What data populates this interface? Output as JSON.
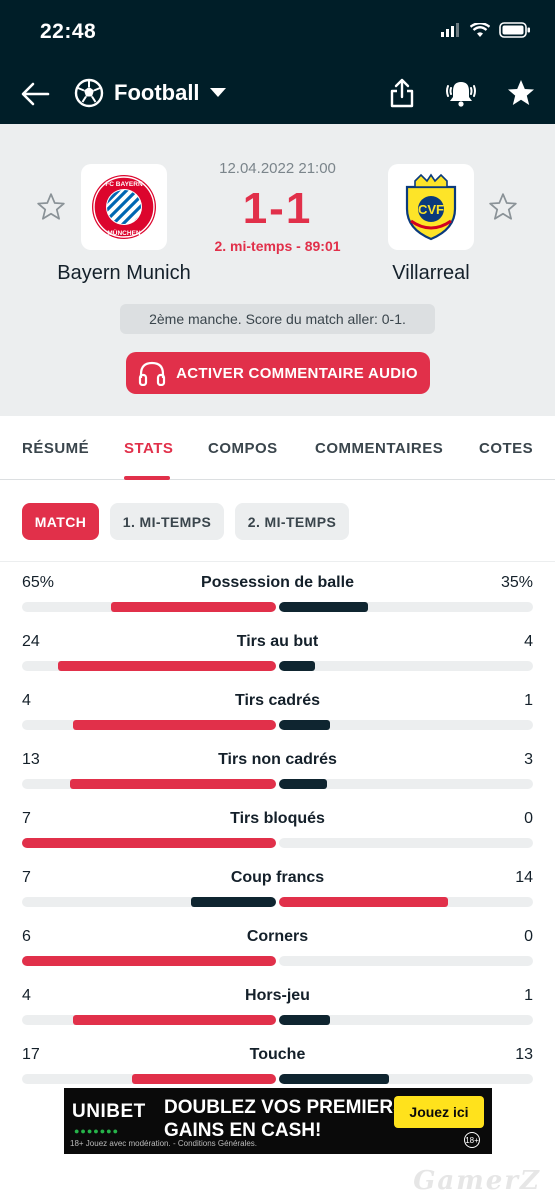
{
  "status_bar": {
    "time": "22:48"
  },
  "app_bar": {
    "sport": "Football"
  },
  "match": {
    "date": "12.04.2022 21:00",
    "score": "1-1",
    "period": "2. mi-temps - 89:01",
    "home_team": "Bayern Munich",
    "away_team": "Villarreal",
    "info": "2ème manche. Score du match aller: 0-1.",
    "audio_button": "ACTIVER COMMENTAIRE AUDIO",
    "home_logo_text": "FC BAYERN MÜNCHEN",
    "away_logo_text": "CVF"
  },
  "tabs": [
    {
      "label": "RÉSUMÉ"
    },
    {
      "label": "STATS"
    },
    {
      "label": "COMPOS"
    },
    {
      "label": "COMMENTAIRES"
    },
    {
      "label": "COTES"
    }
  ],
  "chips": [
    {
      "label": "MATCH"
    },
    {
      "label": "1. MI-TEMPS"
    },
    {
      "label": "2. MI-TEMPS"
    }
  ],
  "colors": {
    "accent": "#e1304a",
    "dark": "#001e28",
    "track": "#eceeef",
    "navy_bar": "#0f2530"
  },
  "stats": [
    {
      "label": "Possession de balle",
      "home": "65%",
      "away": "35%",
      "home_v": 65,
      "away_v": 35
    },
    {
      "label": "Tirs au but",
      "home": "24",
      "away": "4",
      "home_v": 24,
      "away_v": 4
    },
    {
      "label": "Tirs cadrés",
      "home": "4",
      "away": "1",
      "home_v": 4,
      "away_v": 1
    },
    {
      "label": "Tirs non cadrés",
      "home": "13",
      "away": "3",
      "home_v": 13,
      "away_v": 3
    },
    {
      "label": "Tirs bloqués",
      "home": "7",
      "away": "0",
      "home_v": 7,
      "away_v": 0
    },
    {
      "label": "Coup francs",
      "home": "7",
      "away": "14",
      "home_v": 7,
      "away_v": 14
    },
    {
      "label": "Corners",
      "home": "6",
      "away": "0",
      "home_v": 6,
      "away_v": 0
    },
    {
      "label": "Hors-jeu",
      "home": "4",
      "away": "1",
      "home_v": 4,
      "away_v": 1
    },
    {
      "label": "Touche",
      "home": "17",
      "away": "13",
      "home_v": 17,
      "away_v": 13
    }
  ],
  "ad": {
    "brand": "UNIBET",
    "brand_dots": "●●●●●●●",
    "headline_1": "DOUBLEZ VOS PREMIERS",
    "headline_2": "GAINS EN CASH!",
    "cta": "Jouez ici",
    "fine_print": "18+ Jouez avec modération. - Conditions Générales.",
    "age_badge": "18+"
  },
  "watermark": "GamerZ"
}
